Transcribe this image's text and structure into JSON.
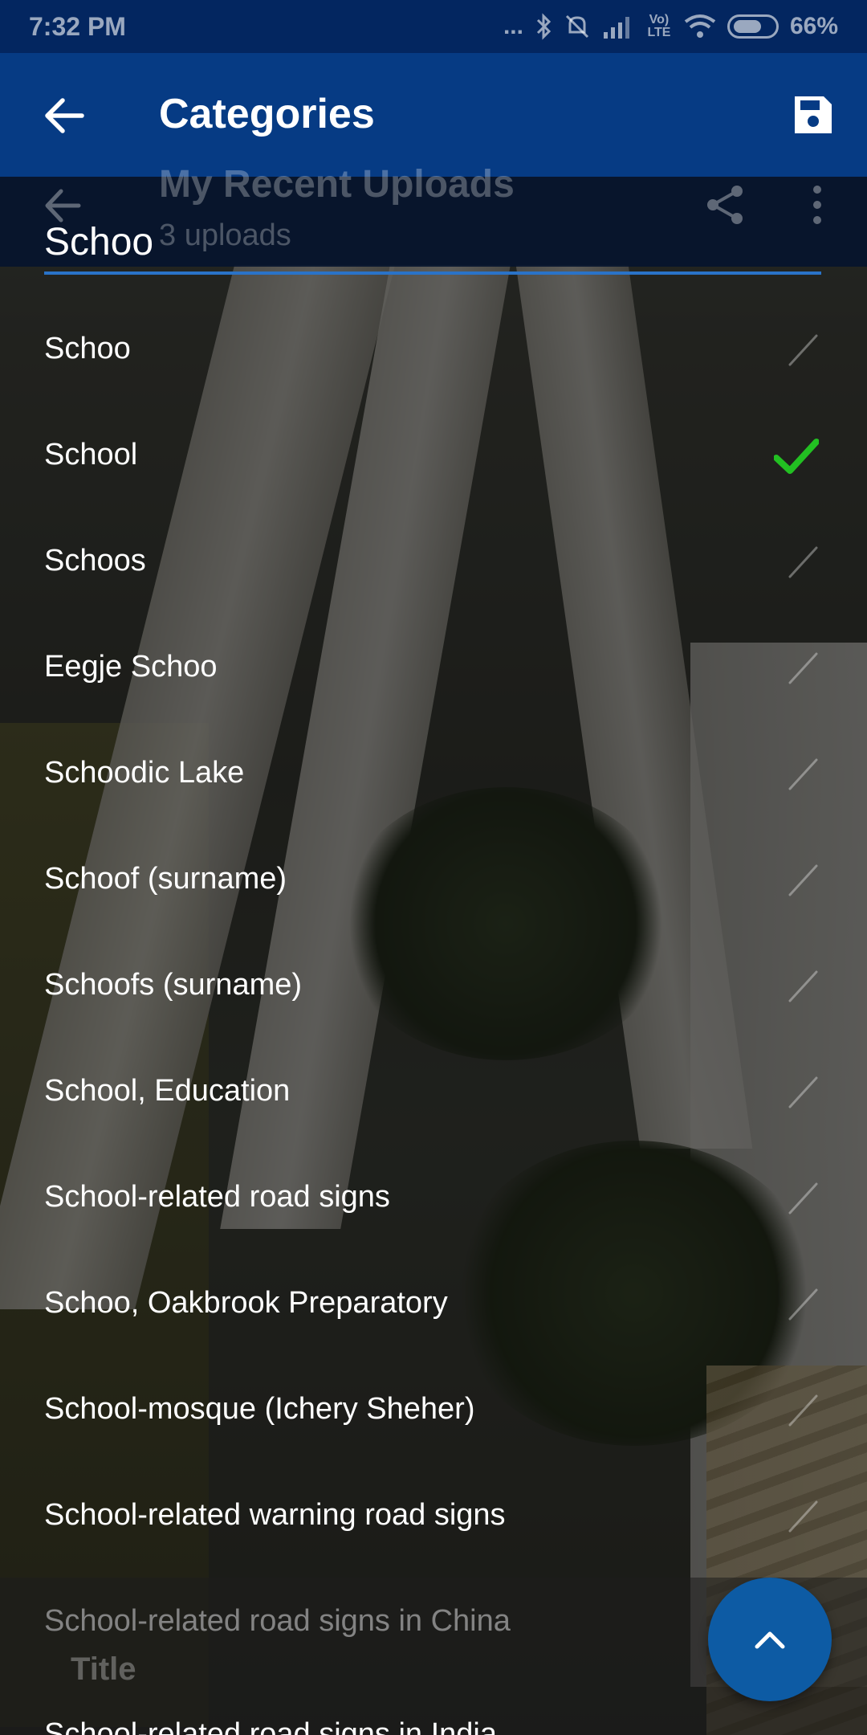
{
  "status_bar": {
    "time": "7:32 PM",
    "dots": "...",
    "battery_percent": "66%",
    "icons": [
      "bluetooth-icon",
      "mute-icon",
      "signal-icon",
      "volte-icon",
      "wifi-icon",
      "battery-icon"
    ],
    "volte_label": "Vo) LTE"
  },
  "app_bar": {
    "title": "Categories",
    "back_icon": "arrow-back-icon",
    "save_icon": "save-icon"
  },
  "background_screen": {
    "title": "My Recent Uploads",
    "subtitle": "3 uploads",
    "bottom_title": "Title"
  },
  "search": {
    "value": "Schoo"
  },
  "categories": [
    {
      "label": "Schoo",
      "checked": false
    },
    {
      "label": "School",
      "checked": true
    },
    {
      "label": "Schoos",
      "checked": false
    },
    {
      "label": "Eegje Schoo",
      "checked": false
    },
    {
      "label": "Schoodic Lake",
      "checked": false
    },
    {
      "label": "Schoof (surname)",
      "checked": false
    },
    {
      "label": "Schoofs (surname)",
      "checked": false
    },
    {
      "label": "School, Education",
      "checked": false
    },
    {
      "label": "School-related road signs",
      "checked": false
    },
    {
      "label": "Schoo, Oakbrook Preparatory",
      "checked": false
    },
    {
      "label": "School-mosque (Ichery Sheher)",
      "checked": false
    },
    {
      "label": "School-related warning road signs",
      "checked": false
    },
    {
      "label": "School-related road signs in China",
      "checked": false
    }
  ],
  "partial_row": "School-related road signs in India",
  "fab": {
    "icon": "chevron-up-icon"
  },
  "colors": {
    "status_bar": "#032660",
    "app_bar": "#063b84",
    "accent": "#2a73c8",
    "check_active": "#22c022",
    "fab": "#0d5ba4"
  }
}
